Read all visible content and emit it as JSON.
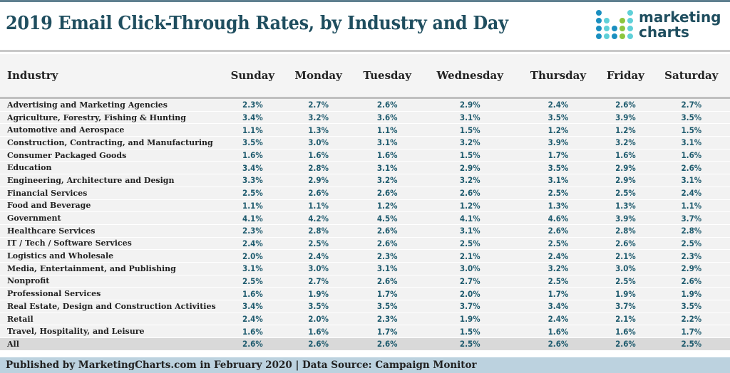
{
  "title": "2019 Email Click-Through Rates, by Industry and Day",
  "logo": {
    "line1": "marketing",
    "line2": "charts",
    "colors": {
      "blue": "#1a8fc0",
      "teal": "#5fd0d8",
      "green": "#8cc63f"
    }
  },
  "footer": "Published by MarketingCharts.com in February 2020 | Data Source: Campaign Monitor",
  "colors": {
    "title": "#1f4e5f",
    "value": "#1f5b6e",
    "footer_bg": "#bcd2df",
    "row_bg": "#f2f2f2",
    "total_row_bg": "#d9d9d9"
  },
  "chart_data": {
    "type": "table",
    "title": "2019 Email Click-Through Rates, by Industry and Day",
    "columns": [
      "Industry",
      "Sunday",
      "Monday",
      "Tuesday",
      "Wednesday",
      "Thursday",
      "Friday",
      "Saturday"
    ],
    "rows": [
      {
        "industry": "Advertising and Marketing Agencies",
        "values": [
          "2.3%",
          "2.7%",
          "2.6%",
          "2.9%",
          "2.4%",
          "2.6%",
          "2.7%"
        ]
      },
      {
        "industry": "Agriculture, Forestry, Fishing & Hunting",
        "values": [
          "3.4%",
          "3.2%",
          "3.6%",
          "3.1%",
          "3.5%",
          "3.9%",
          "3.5%"
        ]
      },
      {
        "industry": "Automotive and Aerospace",
        "values": [
          "1.1%",
          "1.3%",
          "1.1%",
          "1.5%",
          "1.2%",
          "1.2%",
          "1.5%"
        ]
      },
      {
        "industry": "Construction, Contracting, and Manufacturing",
        "values": [
          "3.5%",
          "3.0%",
          "3.1%",
          "3.2%",
          "3.9%",
          "3.2%",
          "3.1%"
        ]
      },
      {
        "industry": "Consumer Packaged Goods",
        "values": [
          "1.6%",
          "1.6%",
          "1.6%",
          "1.5%",
          "1.7%",
          "1.6%",
          "1.6%"
        ]
      },
      {
        "industry": "Education",
        "values": [
          "3.4%",
          "2.8%",
          "3.1%",
          "2.9%",
          "3.5%",
          "2.9%",
          "2.6%"
        ]
      },
      {
        "industry": "Engineering, Architecture and Design",
        "values": [
          "3.3%",
          "2.9%",
          "3.2%",
          "3.2%",
          "3.1%",
          "2.9%",
          "3.1%"
        ]
      },
      {
        "industry": "Financial Services",
        "values": [
          "2.5%",
          "2.6%",
          "2.6%",
          "2.6%",
          "2.5%",
          "2.5%",
          "2.4%"
        ]
      },
      {
        "industry": "Food and Beverage",
        "values": [
          "1.1%",
          "1.1%",
          "1.2%",
          "1.2%",
          "1.3%",
          "1.3%",
          "1.1%"
        ]
      },
      {
        "industry": "Government",
        "values": [
          "4.1%",
          "4.2%",
          "4.5%",
          "4.1%",
          "4.6%",
          "3.9%",
          "3.7%"
        ]
      },
      {
        "industry": "Healthcare Services",
        "values": [
          "2.3%",
          "2.8%",
          "2.6%",
          "3.1%",
          "2.6%",
          "2.8%",
          "2.8%"
        ]
      },
      {
        "industry": "IT / Tech / Software Services",
        "values": [
          "2.4%",
          "2.5%",
          "2.6%",
          "2.5%",
          "2.5%",
          "2.6%",
          "2.5%"
        ]
      },
      {
        "industry": "Logistics and Wholesale",
        "values": [
          "2.0%",
          "2.4%",
          "2.3%",
          "2.1%",
          "2.4%",
          "2.1%",
          "2.3%"
        ]
      },
      {
        "industry": "Media, Entertainment, and Publishing",
        "values": [
          "3.1%",
          "3.0%",
          "3.1%",
          "3.0%",
          "3.2%",
          "3.0%",
          "2.9%"
        ]
      },
      {
        "industry": "Nonprofit",
        "values": [
          "2.5%",
          "2.7%",
          "2.6%",
          "2.7%",
          "2.5%",
          "2.5%",
          "2.6%"
        ]
      },
      {
        "industry": "Professional Services",
        "values": [
          "1.6%",
          "1.9%",
          "1.7%",
          "2.0%",
          "1.7%",
          "1.9%",
          "1.9%"
        ]
      },
      {
        "industry": "Real Estate, Design and Construction Activities",
        "values": [
          "3.4%",
          "3.5%",
          "3.5%",
          "3.7%",
          "3.4%",
          "3.7%",
          "3.5%"
        ]
      },
      {
        "industry": "Retail",
        "values": [
          "2.4%",
          "2.0%",
          "2.3%",
          "1.9%",
          "2.4%",
          "2.1%",
          "2.2%"
        ]
      },
      {
        "industry": "Travel, Hospitality, and Leisure",
        "values": [
          "1.6%",
          "1.6%",
          "1.7%",
          "1.5%",
          "1.6%",
          "1.6%",
          "1.7%"
        ]
      },
      {
        "industry": "All",
        "values": [
          "2.6%",
          "2.6%",
          "2.6%",
          "2.5%",
          "2.6%",
          "2.6%",
          "2.5%"
        ]
      }
    ]
  }
}
